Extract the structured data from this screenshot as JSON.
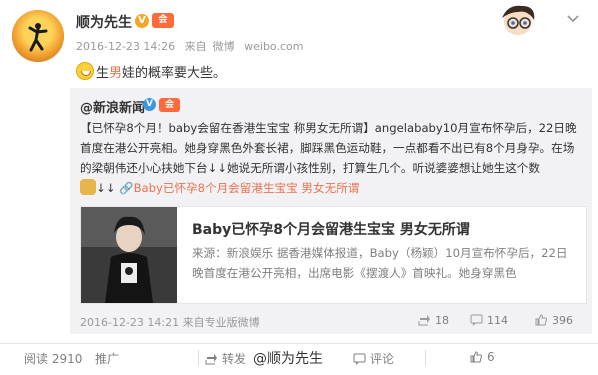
{
  "post": {
    "author": "顺为先生",
    "verified_badge": "V",
    "vip_badge": "会",
    "timestamp": "2016-12-23 14:26",
    "source_prefix": "来自",
    "source": "微博",
    "site": "weibo.com",
    "text_before": "生",
    "text_highlight": "男",
    "text_after": "娃的概率要大些。",
    "emoji_icon": "grin-emoji-icon"
  },
  "repost": {
    "author": "@新浪新闻",
    "verified_badge": "V",
    "vip_badge": "会",
    "text": "【已怀孕8个月！baby会留在香港生宝宝 称男女无所谓】angelababy10月宣布怀孕后，22日晚首度在港公开亮相。她身穿黑色外套长裙，脚踩黑色运动鞋，一点都看不出已有8个月身孕。在场的梁朝伟还小心扶她下台↓↓她说无所谓小孩性别，打算生几个。听说婆婆想让她生这个数",
    "arrows": "↓↓",
    "link_text": "Baby已怀孕8个月会留港生宝宝 男女无所谓",
    "card": {
      "title": "Baby已怀孕8个月会留港生宝宝 男女无所谓",
      "desc": "来源：新浪娱乐 据香港媒体报道，Baby（杨颖）10月宣布怀孕后，22日晚首度在港公开亮相，出席电影《摆渡人》首映礼。她身穿黑色"
    },
    "timestamp": "2016-12-23 14:21",
    "source_prefix": "来自",
    "source": "专业版微博",
    "reposts": "18",
    "comments": "114",
    "likes": "396"
  },
  "footer": {
    "read_label": "阅读",
    "read_count": "2910",
    "promote": "推广",
    "repost": "转发",
    "at_user": "@顺为先生",
    "comment": "评论",
    "like_count": "6"
  },
  "colors": {
    "accent": "#eb7350",
    "muted": "#808080",
    "repost_bg": "#f2f2f5"
  }
}
